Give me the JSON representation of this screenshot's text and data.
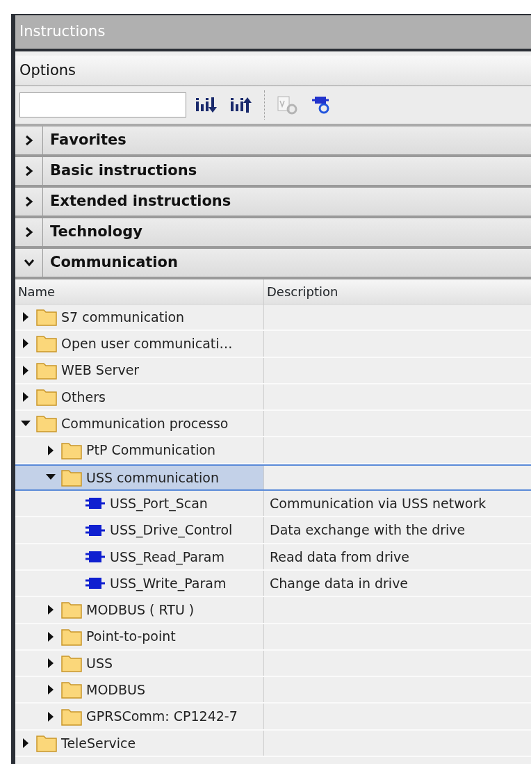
{
  "panel": {
    "title": "Instructions"
  },
  "options": {
    "label": "Options"
  },
  "toolbar": {
    "buttons": [
      {
        "kind": "sort-down",
        "disabled": false
      },
      {
        "kind": "sort-up",
        "disabled": false
      },
      {
        "kind": "version",
        "disabled": true
      },
      {
        "kind": "version-update",
        "disabled": false
      }
    ]
  },
  "sections": [
    {
      "label": "Favorites",
      "expanded": false
    },
    {
      "label": "Basic instructions",
      "expanded": false
    },
    {
      "label": "Extended instructions",
      "expanded": false
    },
    {
      "label": "Technology",
      "expanded": false
    },
    {
      "label": "Communication",
      "expanded": true
    }
  ],
  "table": {
    "columns": [
      "Name",
      "Description"
    ],
    "rows": [
      {
        "kind": "folder",
        "name": "S7 communication",
        "expanded": false,
        "selected": false
      },
      {
        "kind": "folder",
        "name": "Open user communicati…",
        "expanded": false,
        "selected": false
      },
      {
        "kind": "folder",
        "name": "WEB Server",
        "expanded": false,
        "selected": false
      },
      {
        "kind": "folder",
        "name": "Others",
        "expanded": false,
        "selected": false
      },
      {
        "kind": "folder",
        "name": "Communication processo",
        "expanded": true,
        "selected": false,
        "children": [
          {
            "kind": "folder",
            "name": "PtP Communication",
            "expanded": false,
            "selected": false
          },
          {
            "kind": "folder",
            "name": "USS communication",
            "expanded": true,
            "selected": true,
            "children": [
              {
                "kind": "block",
                "name": "USS_Port_Scan",
                "description": "Communication via USS network",
                "selected": false
              },
              {
                "kind": "block",
                "name": "USS_Drive_Control",
                "description": "Data exchange with the drive",
                "selected": false
              },
              {
                "kind": "block",
                "name": "USS_Read_Param",
                "description": "Read data from drive",
                "selected": false
              },
              {
                "kind": "block",
                "name": "USS_Write_Param",
                "description": "Change data in drive",
                "selected": false
              }
            ]
          },
          {
            "kind": "folder",
            "name": "MODBUS ( RTU )",
            "expanded": false,
            "selected": false
          },
          {
            "kind": "folder",
            "name": "Point-to-point",
            "expanded": false,
            "selected": false
          },
          {
            "kind": "folder",
            "name": "USS",
            "expanded": false,
            "selected": false
          },
          {
            "kind": "folder",
            "name": "MODBUS",
            "expanded": false,
            "selected": false
          },
          {
            "kind": "folder",
            "name": "GPRSComm: CP1242-7",
            "expanded": false,
            "selected": false
          }
        ]
      },
      {
        "kind": "folder",
        "name": "TeleService",
        "expanded": false,
        "selected": false
      }
    ]
  }
}
